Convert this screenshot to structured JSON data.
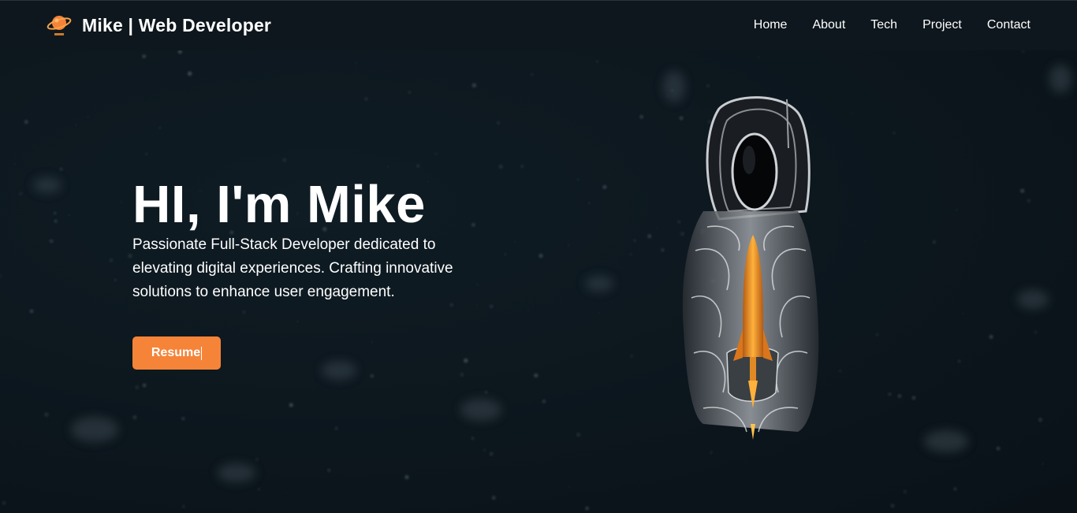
{
  "header": {
    "brand_title": "Mike | Web Developer",
    "logo_icon": "planet-logo-icon",
    "nav": [
      {
        "label": "Home"
      },
      {
        "label": "About"
      },
      {
        "label": "Tech"
      },
      {
        "label": "Project"
      },
      {
        "label": "Contact"
      }
    ]
  },
  "hero": {
    "title": "HI, I'm Mike",
    "description": "Passionate Full-Stack Developer dedicated to elevating digital experiences. Crafting innovative solutions to enhance user engagement.",
    "resume_label": "Resume",
    "illustration_icon": "astronaut-with-rocket-illustration"
  },
  "colors": {
    "background": "#0d161d",
    "header_background": "#0e171d",
    "accent": "#f58439",
    "text": "#ffffff"
  }
}
